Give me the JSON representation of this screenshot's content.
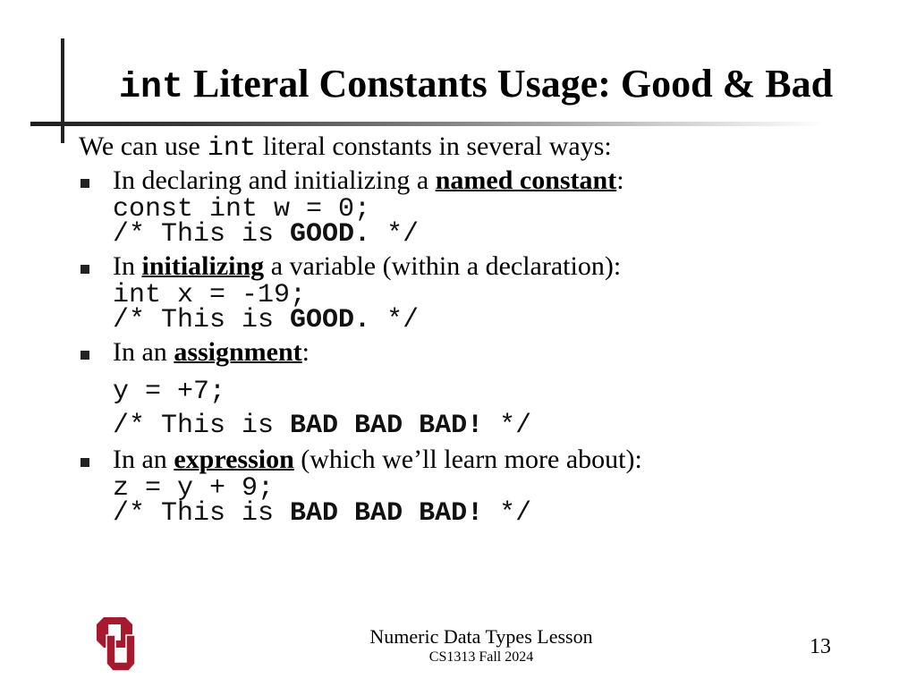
{
  "slide": {
    "title_mono": "int",
    "title_text": " Literal Constants Usage: Good & Bad",
    "intro": {
      "before": "We can use",
      "mono": "int",
      "after": "literal constants in several ways:"
    },
    "items": [
      {
        "before": "In declaring and initializing a ",
        "emph": "named constant",
        "after": ":",
        "code_line": "const int w = 0;",
        "comment_prefix": "/* This is ",
        "comment_bold": "GOOD.",
        "comment_suffix": " */"
      },
      {
        "before": "In ",
        "emph": "initializing",
        "after": " a variable (within a declaration):",
        "code_line": "int x = -19;",
        "comment_prefix": "/* This is ",
        "comment_bold": "GOOD.",
        "comment_suffix": " */"
      },
      {
        "before": "In an ",
        "emph": "assignment",
        "after": ":",
        "code_line": "y = +7;",
        "comment_prefix": "/* This is ",
        "comment_bold": "BAD BAD BAD!",
        "comment_suffix": " */"
      },
      {
        "before": "In an ",
        "emph": "expression",
        "after": " (which we’ll learn more about):",
        "code_line": "z = y + 9;",
        "comment_prefix": "/* This is ",
        "comment_bold": "BAD BAD BAD!",
        "comment_suffix": " */"
      }
    ]
  },
  "footer": {
    "title": "Numeric Data Types Lesson",
    "subtitle": "CS1313 Fall 2024",
    "page_number": "13",
    "logo": "ou-logo-icon",
    "logo_color": "#A6192E"
  }
}
